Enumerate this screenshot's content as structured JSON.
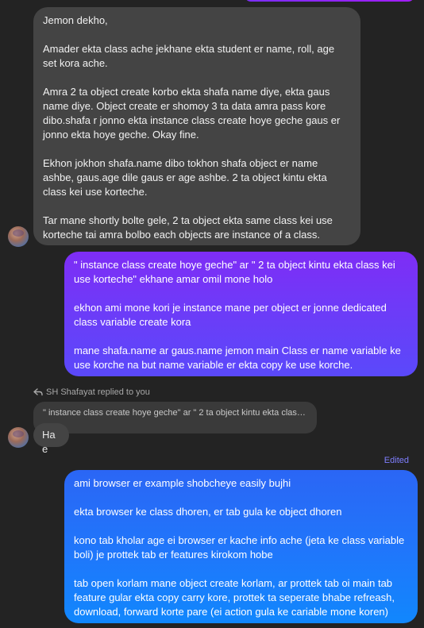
{
  "messages": {
    "first": "Jemon dekho,\n\nAmader ekta class ache jekhane ekta student er name, roll, age set kora ache.\n\nAmra 2 ta object create korbo ekta shafa name diye, ekta gaus name diye. Object create er shomoy 3 ta data amra pass kore dibo.shafa r jonno ekta instance class create hoye geche gaus er jonno ekta hoye geche. Okay fine.\n\nEkhon jokhon shafa.name dibo tokhon shafa object er name ashbe, gaus.age dile gaus er age ashbe. 2 ta object kintu ekta class kei use korteche.\n\nTar mane shortly bolte gele, 2 ta object ekta same class kei use korteche tai amra bolbo each objects are instance of a class.",
    "second": "\" instance class create hoye geche\" ar \" 2 ta object kintu ekta class kei use korteche\" ekhane amar omil mone holo\n\nekhon ami mone kori je instance mane per object er jonne dedicated class variable create kora\n\nmane shafa.name ar gaus.name jemon main Class er name variable ke use korche na but name variable er ekta copy ke use korche.",
    "reply_label": "SH Shafayat replied to you",
    "reply_quote": "\" instance class create hoye geche\" ar \" 2 ta object kintu ekta class ke...",
    "hae": "Hae",
    "edited": "Edited",
    "third": "ami browser er example shobcheye easily bujhi\n\nekta browser ke class dhoren, er tab gula ke object dhoren\n\nkono tab kholar age ei browser er kache info ache (jeta ke class variable boli) je prottek tab er features kirokom hobe\n\ntab open korlam mane object create korlam, ar prottek tab oi main tab feature gular ekta copy carry kore, prottek ta seperate bhabe refreash, download, forward korte pare (ei action gula ke cariable mone koren)"
  },
  "colors": {
    "background": "#232323",
    "incoming_bubble": "#444444",
    "outgoing_purple": "#6c3cf8",
    "outgoing_blue": "#1f77fb"
  },
  "icons": {
    "reply": "reply-arrow-icon"
  }
}
